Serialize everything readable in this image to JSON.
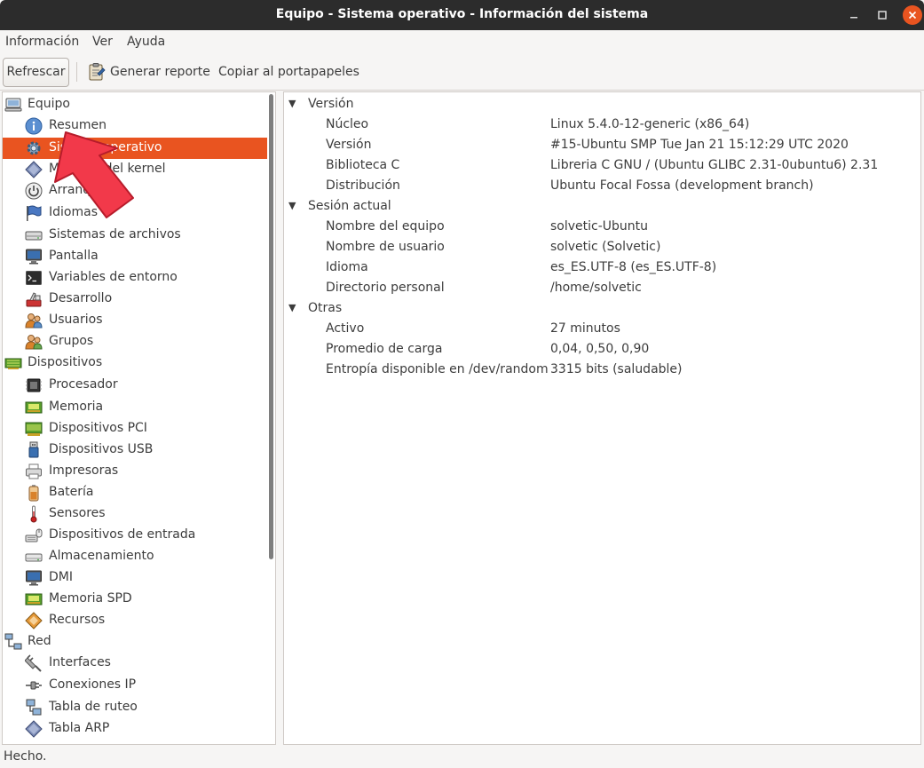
{
  "window": {
    "title": "Equipo - Sistema operativo - Información del sistema"
  },
  "menubar": {
    "items": [
      "Información",
      "Ver",
      "Ayuda"
    ]
  },
  "toolbar": {
    "refresh_label": "Refrescar",
    "report_label": "Generar reporte",
    "copy_label": "Copiar al portapapeles"
  },
  "sidebar": {
    "rows": [
      {
        "label": "Equipo",
        "icon": "computer-icon"
      },
      {
        "label": "Resumen",
        "icon": "info-icon"
      },
      {
        "label": "Sistema operativo",
        "icon": "gear-icon"
      },
      {
        "label": "Módulos del kernel",
        "icon": "diamond-icon"
      },
      {
        "label": "Arranques",
        "icon": "power-icon"
      },
      {
        "label": "Idiomas",
        "icon": "flag-icon"
      },
      {
        "label": "Sistemas de archivos",
        "icon": "drive-icon"
      },
      {
        "label": "Pantalla",
        "icon": "monitor-icon"
      },
      {
        "label": "Variables de entorno",
        "icon": "terminal-icon"
      },
      {
        "label": "Desarrollo",
        "icon": "tools-icon"
      },
      {
        "label": "Usuarios",
        "icon": "users-icon"
      },
      {
        "label": "Grupos",
        "icon": "group-icon"
      },
      {
        "label": "Dispositivos",
        "icon": "board-icon"
      },
      {
        "label": "Procesador",
        "icon": "cpu-icon"
      },
      {
        "label": "Memoria",
        "icon": "memory-icon"
      },
      {
        "label": "Dispositivos PCI",
        "icon": "pci-card-icon"
      },
      {
        "label": "Dispositivos USB",
        "icon": "usb-icon"
      },
      {
        "label": "Impresoras",
        "icon": "printer-icon"
      },
      {
        "label": "Batería",
        "icon": "battery-icon"
      },
      {
        "label": "Sensores",
        "icon": "thermometer-icon"
      },
      {
        "label": "Dispositivos de entrada",
        "icon": "keyboard-mouse-icon"
      },
      {
        "label": "Almacenamiento",
        "icon": "storage-icon"
      },
      {
        "label": "DMI",
        "icon": "dmi-icon"
      },
      {
        "label": "Memoria SPD",
        "icon": "spd-icon"
      },
      {
        "label": "Recursos",
        "icon": "resources-icon"
      },
      {
        "label": "Red",
        "icon": "network-icon"
      },
      {
        "label": "Interfaces",
        "icon": "plug-icon"
      },
      {
        "label": "Conexiones IP",
        "icon": "ip-connection-icon"
      },
      {
        "label": "Tabla de ruteo",
        "icon": "routing-icon"
      },
      {
        "label": "Tabla ARP",
        "icon": "arp-icon"
      }
    ]
  },
  "details": {
    "version": {
      "title": "Versión",
      "rows": [
        {
          "key": "Núcleo",
          "value": "Linux 5.4.0-12-generic (x86_64)"
        },
        {
          "key": "Versión",
          "value": "#15-Ubuntu SMP Tue Jan 21 15:12:29 UTC 2020"
        },
        {
          "key": "Biblioteca C",
          "value": "Libreria C GNU / (Ubuntu GLIBC 2.31-0ubuntu6) 2.31"
        },
        {
          "key": "Distribución",
          "value": "Ubuntu Focal Fossa (development branch)"
        }
      ]
    },
    "session": {
      "title": "Sesión actual",
      "rows": [
        {
          "key": "Nombre del equipo",
          "value": "solvetic-Ubuntu"
        },
        {
          "key": "Nombre de usuario",
          "value": "solvetic (Solvetic)"
        },
        {
          "key": "Idioma",
          "value": "es_ES.UTF-8 (es_ES.UTF-8)"
        },
        {
          "key": "Directorio personal",
          "value": "/home/solvetic"
        }
      ]
    },
    "other": {
      "title": "Otras",
      "rows": [
        {
          "key": "Activo",
          "value": "27 minutos"
        },
        {
          "key": "Promedio de carga",
          "value": "0,04, 0,50, 0,90"
        },
        {
          "key": "Entropía disponible en /dev/random",
          "value": "3315 bits (saludable)"
        }
      ]
    }
  },
  "statusbar": {
    "text": "Hecho."
  },
  "colors": {
    "accent": "#e95420",
    "titlebar": "#2c2c2c",
    "arrow": "#f2394a"
  }
}
